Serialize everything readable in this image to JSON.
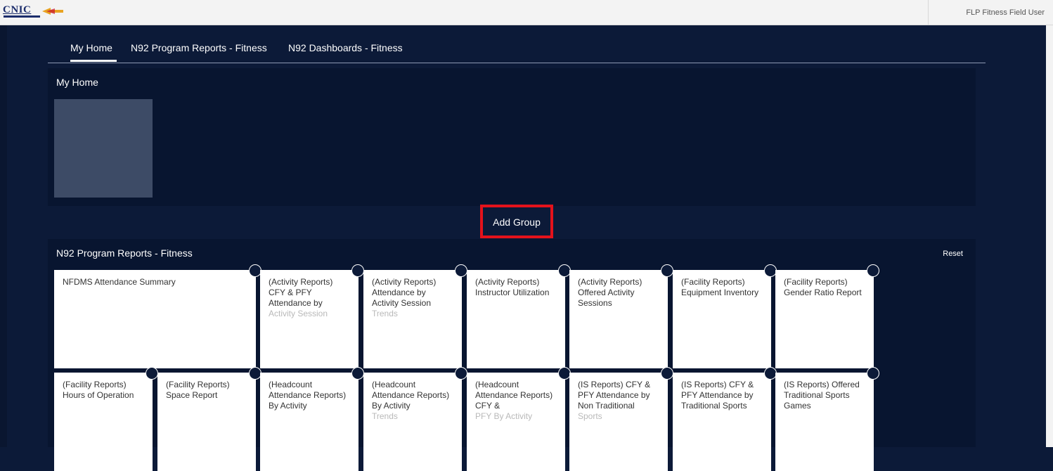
{
  "header": {
    "logo_text": "CNIC",
    "user_name": "FLP Fitness Field User"
  },
  "nav": {
    "tabs": [
      {
        "label": "My Home",
        "active": true
      },
      {
        "label": "N92 Program Reports - Fitness",
        "active": false
      },
      {
        "label": "N92 Dashboards - Fitness",
        "active": false
      }
    ]
  },
  "home_group": {
    "title": "My Home"
  },
  "add_group": {
    "label": "Add Group"
  },
  "reports_group": {
    "title": "N92 Program Reports - Fitness",
    "reset_label": "Reset",
    "tiles": [
      {
        "title": "NFDMS Attendance Summary",
        "faded": ""
      },
      {
        "title": "(Activity Reports) CFY & PFY Attendance by",
        "faded": "Activity Session"
      },
      {
        "title": "(Activity Reports) Attendance by Activity Session",
        "faded": "Trends"
      },
      {
        "title": "(Activity Reports) Instructor Utilization",
        "faded": ""
      },
      {
        "title": "(Activity Reports) Offered Activity Sessions",
        "faded": ""
      },
      {
        "title": "(Facility Reports) Equipment Inventory",
        "faded": ""
      },
      {
        "title": "(Facility Reports) Gender Ratio Report",
        "faded": ""
      },
      {
        "title": "(Facility Reports) Hours of Operation",
        "faded": ""
      },
      {
        "title": "(Facility Reports) Space Report",
        "faded": ""
      },
      {
        "title": "(Headcount Attendance Reports) By Activity",
        "faded": ""
      },
      {
        "title": "(Headcount Attendance Reports) By Activity",
        "faded": "Trends"
      },
      {
        "title": "(Headcount Attendance Reports) CFY &",
        "faded": "PFY By Activity"
      },
      {
        "title": "(IS Reports) CFY & PFY Attendance by Non Traditional",
        "faded": "Sports"
      },
      {
        "title": "(IS Reports) CFY & PFY Attendance by Traditional Sports",
        "faded": ""
      },
      {
        "title": "(IS Reports) Offered Traditional Sports Games",
        "faded": ""
      }
    ]
  },
  "colors": {
    "page_background": "#0c1a38",
    "section_background": "#081530",
    "highlight_border": "#e4121b",
    "tile_background": "#ffffff"
  }
}
